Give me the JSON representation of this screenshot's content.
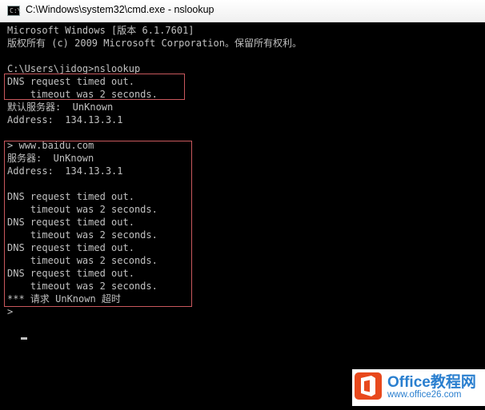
{
  "window": {
    "title": "C:\\Windows\\system32\\cmd.exe - nslookup"
  },
  "console": {
    "lines": [
      "Microsoft Windows [版本 6.1.7601]",
      "版权所有 (c) 2009 Microsoft Corporation。保留所有权利。",
      "",
      "C:\\Users\\jidog>nslookup",
      "DNS request timed out.",
      "    timeout was 2 seconds.",
      "默认服务器:  UnKnown",
      "Address:  134.13.3.1",
      "",
      "> www.baidu.com",
      "服务器:  UnKnown",
      "Address:  134.13.3.1",
      "",
      "DNS request timed out.",
      "    timeout was 2 seconds.",
      "DNS request timed out.",
      "    timeout was 2 seconds.",
      "DNS request timed out.",
      "    timeout was 2 seconds.",
      "DNS request timed out.",
      "    timeout was 2 seconds.",
      "*** 请求 UnKnown 超时",
      ">"
    ]
  },
  "colors": {
    "console_bg": "#000000",
    "console_text": "#c0c0c0",
    "highlight_box": "#c9585d",
    "watermark_brand": "#2a7fcf",
    "watermark_logo": "#e8491d"
  },
  "watermark": {
    "title": "Office教程网",
    "url": "www.office26.com"
  }
}
